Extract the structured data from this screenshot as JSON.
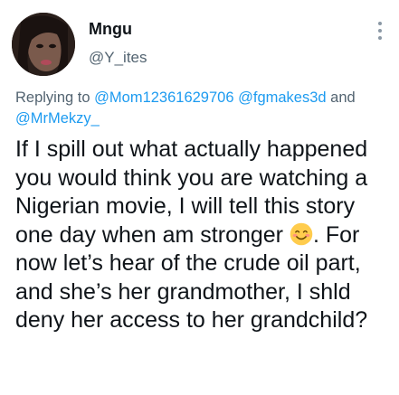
{
  "author": {
    "display_name": "Mngu",
    "handle": "@Y_ites"
  },
  "reply_context": {
    "prefix": "Replying to",
    "mention_1": "@Mom12361629706",
    "mention_2": "@fgmakes3d",
    "joiner": "and",
    "mention_3": "@MrMekzy_"
  },
  "tweet": {
    "text_before_emoji": "If I spill out what actually happened you would think you are watching a Nigerian movie, I will tell this story one day when am stronger",
    "emoji": "smiling-face-with-smiling-eyes",
    "text_after_emoji": ". For now let’s hear of the crude oil part, and she’s her grandmother, I shld deny her access to her grandchild?"
  },
  "colors": {
    "text": "#0f1419",
    "secondary_text": "#536471",
    "mention": "#1d9bf0",
    "emoji_face": "#ffcc4d"
  },
  "icons": {
    "more": "more-options-icon"
  }
}
